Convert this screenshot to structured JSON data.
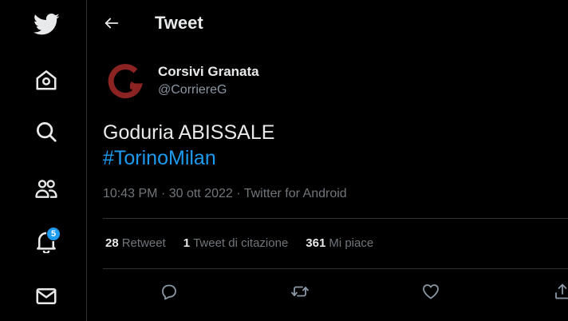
{
  "header": {
    "title": "Tweet"
  },
  "nav": {
    "notifications_badge": "5"
  },
  "tweet": {
    "author_name": "Corsivi Granata",
    "author_handle": "@CorriereG",
    "text_line1": "Goduria ABISSALE",
    "hashtag": "#TorinoMilan",
    "time": "10:43 PM",
    "sep1": "·",
    "date": "30 ott 2022",
    "sep2": "·",
    "source": "Twitter for Android"
  },
  "stats": {
    "retweets_count": "28",
    "retweets_label": "Retweet",
    "quotes_count": "1",
    "quotes_label": "Tweet di citazione",
    "likes_count": "361",
    "likes_label": "Mi piace"
  },
  "colors": {
    "accent": "#1d9bf0",
    "avatar_brand": "#8b2323"
  },
  "icons": {
    "nav": [
      "twitter-logo-icon",
      "home-icon",
      "search-icon",
      "communities-icon",
      "bell-icon",
      "mail-icon"
    ],
    "header": "back-arrow-icon",
    "actions": [
      "reply-icon",
      "retweet-icon",
      "like-icon",
      "share-icon"
    ]
  }
}
